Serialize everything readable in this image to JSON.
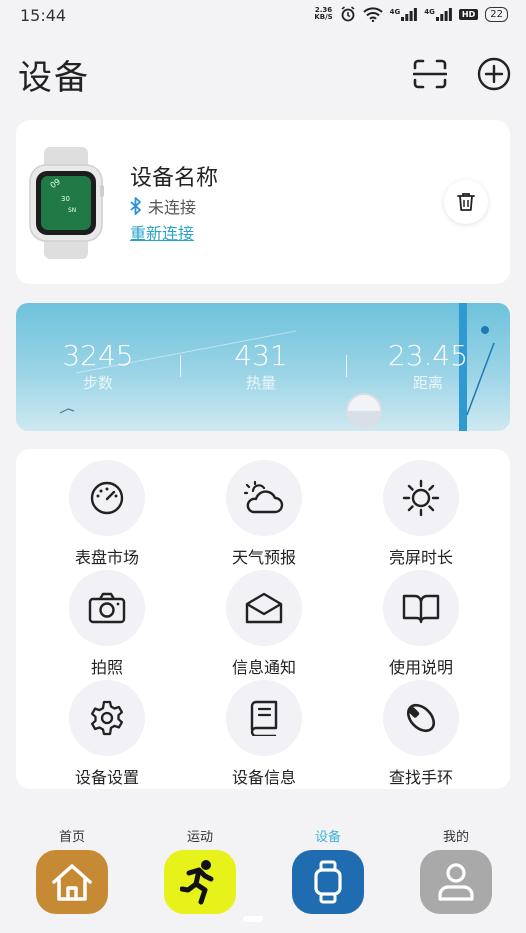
{
  "status_bar": {
    "time": "15:44",
    "speed_value": "2.36",
    "speed_unit": "KB/S",
    "net1": "4G",
    "net2": "4G",
    "hd": "HD",
    "battery": "22"
  },
  "header": {
    "title": "设备"
  },
  "device": {
    "name": "设备名称",
    "status": "未连接",
    "reconnect": "重新连接",
    "watch_face_lines": [
      "09",
      "30",
      "SN"
    ]
  },
  "stats": [
    {
      "value": "3245",
      "label": "步数"
    },
    {
      "value": "431",
      "label": "热量"
    },
    {
      "value": "23.45",
      "label": "距离"
    }
  ],
  "features": [
    {
      "label": "表盘市场",
      "icon": "gauge-icon"
    },
    {
      "label": "天气预报",
      "icon": "weather-icon"
    },
    {
      "label": "亮屏时长",
      "icon": "sun-icon"
    },
    {
      "label": "拍照",
      "icon": "camera-icon"
    },
    {
      "label": "信息通知",
      "icon": "mail-icon"
    },
    {
      "label": "使用说明",
      "icon": "book-open-icon"
    },
    {
      "label": "设备设置",
      "icon": "gear-icon"
    },
    {
      "label": "设备信息",
      "icon": "book-icon"
    },
    {
      "label": "查找手环",
      "icon": "band-icon"
    }
  ],
  "nav": [
    {
      "label": "首页",
      "color": "#c68a35",
      "icon": "home-icon"
    },
    {
      "label": "运动",
      "color": "#e6f21a",
      "icon": "runner-icon"
    },
    {
      "label": "设备",
      "color": "#1f6db0",
      "icon": "watch-icon",
      "active": true,
      "label_color": "#3fb6d6"
    },
    {
      "label": "我的",
      "color": "#a9a9a9",
      "icon": "person-icon"
    }
  ]
}
